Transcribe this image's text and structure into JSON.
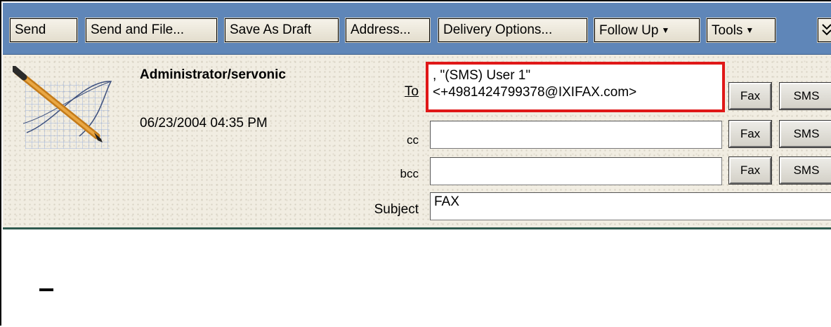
{
  "toolbar": {
    "buttons": [
      {
        "label": "Send"
      },
      {
        "label": "Send and File..."
      },
      {
        "label": "Save As Draft"
      },
      {
        "label": "Address..."
      },
      {
        "label": "Delivery Options..."
      },
      {
        "label": "Follow Up"
      },
      {
        "label": "Tools"
      }
    ],
    "overflow_icon": "double-chevron-down-icon"
  },
  "header": {
    "author": "Administrator/servonic",
    "datetime": "06/23/2004 04:35 PM",
    "to_label": "To",
    "cc_label": "cc",
    "bcc_label": "bcc",
    "subject_label": "Subject",
    "to_value": ", \"(SMS) User 1\"<+4981424799378@IXIFAX.com>",
    "cc_value": "",
    "bcc_value": "",
    "subject_value": "FAX",
    "fax_label": "Fax",
    "sms_label": "SMS",
    "highlight_color": "#e01818"
  },
  "body": {
    "text": ""
  },
  "colors": {
    "toolbar_bg": "#5f86b8",
    "header_bg": "#f1ede2",
    "header_border": "#2f5a4f"
  }
}
